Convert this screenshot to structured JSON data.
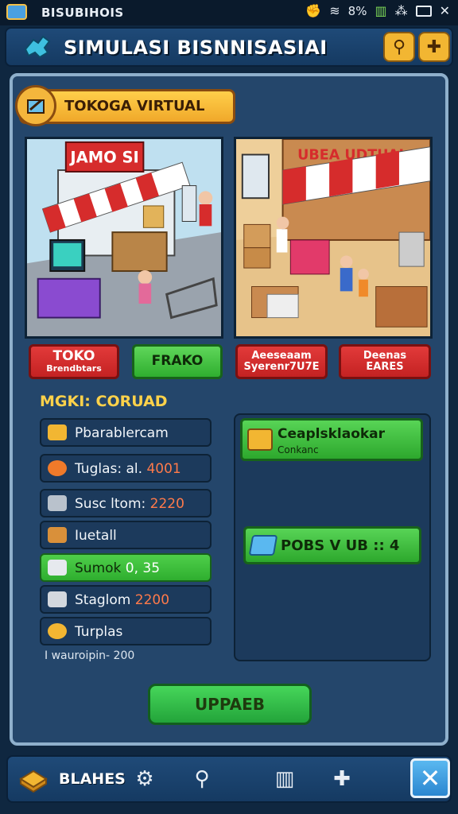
{
  "status_bar": {
    "title": "BISUBIHOIS",
    "battery_text": "8%",
    "icons": [
      "app-icon",
      "wifi-icon",
      "signal-icon",
      "battery-icon",
      "close-icon"
    ]
  },
  "header": {
    "title": "SIMULASI BISNNISASIAI",
    "buttons": [
      "search-icon",
      "puzzle-icon"
    ]
  },
  "banner": {
    "title": "TOKOGA VIRTUAL",
    "icon": "store-icon"
  },
  "scenes": {
    "left_sign": "JAMO SI",
    "right_sign": "UBEA UDTUAL"
  },
  "scene_buttons": [
    {
      "line1": "TOKO",
      "line2": "Brendbtars",
      "color": "#d62c2c"
    },
    {
      "line1": "FRAKO",
      "line2": "",
      "color": "#3cbf3c"
    },
    {
      "line1": "Aeeseaam",
      "line2": "Syerenr7U7E",
      "color": "#d62c2c"
    },
    {
      "line1": "Deenas",
      "line2": "EARES",
      "color": "#d62c2c"
    }
  ],
  "section": {
    "title": "MGKI: CORUAD"
  },
  "list": [
    {
      "label": "Pbarablercam",
      "value": "",
      "icon": "gold-bar-icon",
      "active": false
    },
    {
      "label": "Tuglas: al.",
      "value": "4001",
      "icon": "orange-ball-icon",
      "active": false
    },
    {
      "label": "Susc ltom:",
      "value": "2220",
      "icon": "tools-icon",
      "active": false
    },
    {
      "label": "Iuetall",
      "value": "",
      "icon": "crate-icon",
      "active": false
    },
    {
      "label": "Sumok",
      "value": "0, 35",
      "icon": "box-icon",
      "active": true
    },
    {
      "label": "Staglom",
      "value": "2200",
      "icon": "package-icon",
      "active": false
    },
    {
      "label": "Turplas",
      "value": "",
      "icon": "runner-icon",
      "active": false
    }
  ],
  "footnote": "I wauroipin- 200",
  "right_panel": {
    "card": {
      "title": "Ceaplsklaokar",
      "subtitle": "Conkanc",
      "icon": "gold-bar-icon"
    },
    "stat": {
      "label": "POBS V UB :: 4",
      "icon": "blue-gem-icon"
    }
  },
  "upgrade_button": "UPPAEB",
  "bottom_nav": {
    "label": "BLAHES",
    "icons": [
      "gold-stack-icon",
      "gear-icon",
      "search-icon",
      "map-icon",
      "puzzle-icon",
      "close-icon"
    ]
  },
  "colors": {
    "accent_gold": "#f2b632",
    "panel_blue": "#24466b",
    "action_green": "#2fae2f",
    "alert_red": "#d62c2c",
    "number_orange": "#ff7a4a"
  }
}
